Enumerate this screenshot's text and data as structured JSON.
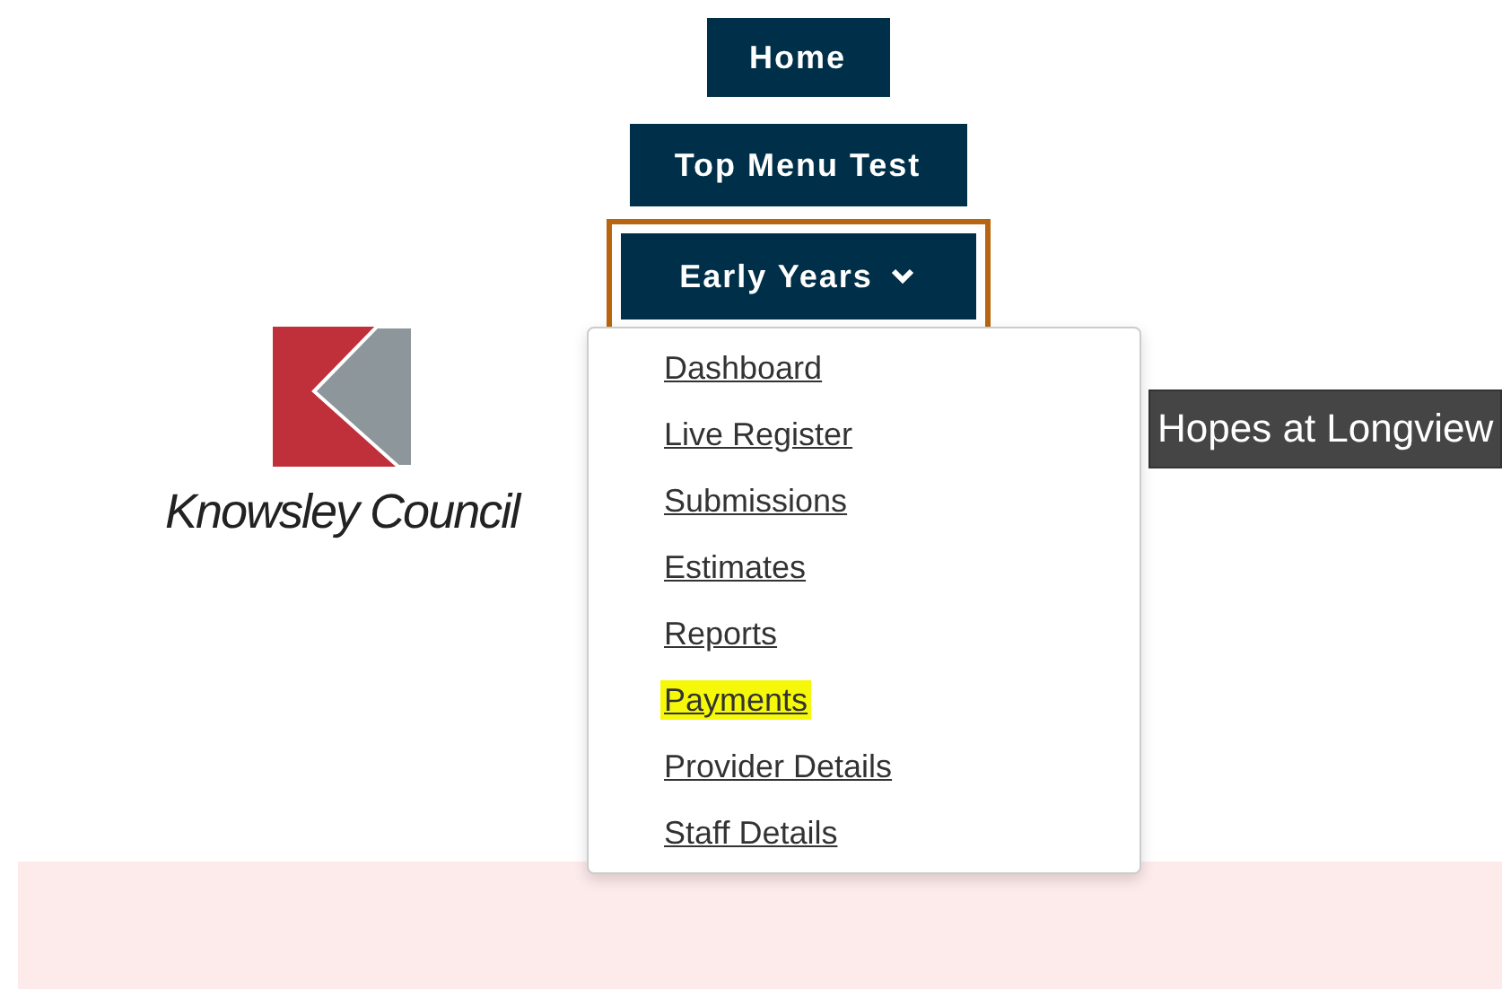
{
  "nav": [
    {
      "label": "Home",
      "kind": "button"
    },
    {
      "label": "Top Menu Test",
      "kind": "button"
    },
    {
      "label": "Early Years",
      "kind": "dropdown",
      "expanded": true,
      "focused": true
    }
  ],
  "dropdown": {
    "items": [
      {
        "label": "Dashboard",
        "highlighted": false
      },
      {
        "label": "Live Register",
        "highlighted": false
      },
      {
        "label": "Submissions",
        "highlighted": false
      },
      {
        "label": "Estimates",
        "highlighted": false
      },
      {
        "label": "Reports",
        "highlighted": false
      },
      {
        "label": "Payments",
        "highlighted": true
      },
      {
        "label": "Provider Details",
        "highlighted": false
      },
      {
        "label": "Staff Details",
        "highlighted": false
      }
    ]
  },
  "logo": {
    "text": "Knowsley Council"
  },
  "provider_bar": {
    "text": "Hopes at Longview"
  }
}
